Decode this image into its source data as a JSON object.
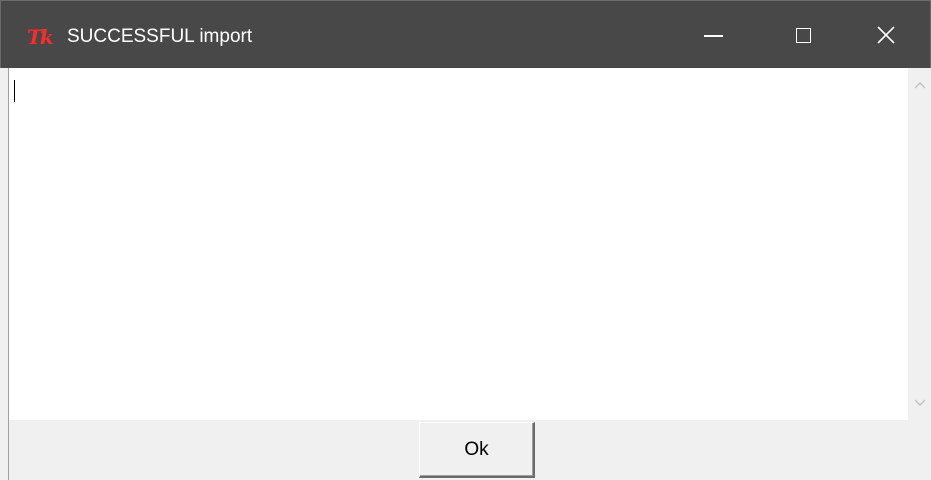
{
  "window": {
    "title": "SUCCESSFUL import",
    "app_icon": "tk-feather-icon",
    "app_icon_text": "Tk",
    "accent_color": "#ff2a2a",
    "titlebar_color": "#484848",
    "controls": {
      "minimize_icon": "minimize-icon",
      "maximize_icon": "maximize-icon",
      "close_icon": "close-icon"
    }
  },
  "content": {
    "text": "",
    "scrollbar": {
      "up_icon": "scroll-up-arrow-icon",
      "down_icon": "scroll-down-arrow-icon"
    }
  },
  "actions": {
    "ok_label": "Ok"
  }
}
